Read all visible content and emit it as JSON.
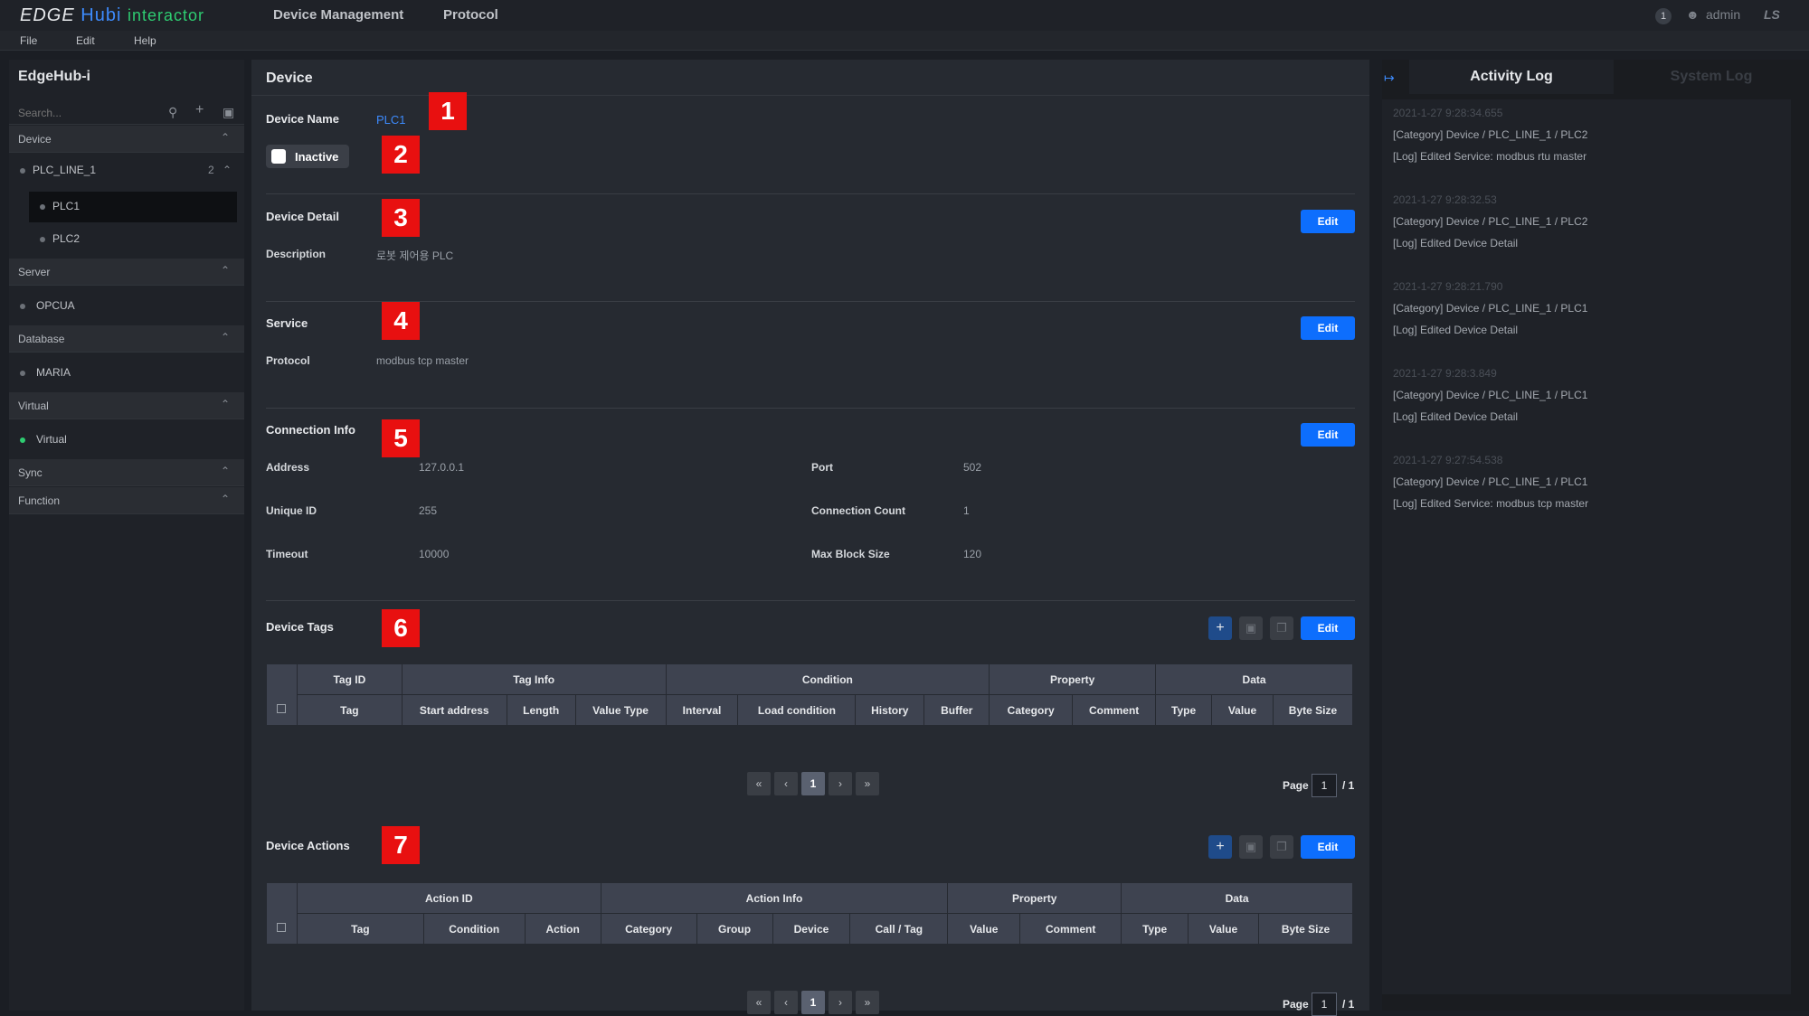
{
  "app": {
    "logo_main": "EDGE",
    "logo_hub": "Hub",
    "logo_sep": "i",
    "logo_sub": "interactor",
    "nav": [
      "Device Management",
      "Protocol"
    ],
    "menu": [
      "File",
      "Edit",
      "Help"
    ],
    "notification_count": "1",
    "user": "admin",
    "brand": "LS"
  },
  "sidebar": {
    "title": "EdgeHub-i",
    "search_placeholder": "Search...",
    "sections": {
      "device": "Device",
      "server": "Server",
      "database": "Database",
      "virtual": "Virtual",
      "sync": "Sync",
      "function": "Function"
    },
    "group": {
      "label": "PLC_LINE_1",
      "count": "2"
    },
    "devices": [
      "PLC1",
      "PLC2"
    ],
    "server_items": [
      "OPCUA"
    ],
    "database_items": [
      "MARIA"
    ],
    "virtual_items": [
      "Virtual"
    ]
  },
  "main": {
    "title": "Device",
    "device_name_label": "Device Name",
    "device_name": "PLC1",
    "status": "Inactive",
    "markers": [
      "1",
      "2",
      "3",
      "4",
      "5",
      "6",
      "7"
    ],
    "edit_label": "Edit",
    "detail": {
      "title": "Device Detail",
      "desc_label": "Description",
      "desc": "로봇 제어용 PLC"
    },
    "service": {
      "title": "Service",
      "protocol_label": "Protocol",
      "protocol": "modbus tcp master"
    },
    "connection": {
      "title": "Connection Info",
      "address_label": "Address",
      "address": "127.0.0.1",
      "port_label": "Port",
      "port": "502",
      "unique_id_label": "Unique ID",
      "unique_id": "255",
      "conn_count_label": "Connection Count",
      "conn_count": "1",
      "timeout_label": "Timeout",
      "timeout": "10000",
      "max_block_label": "Max Block Size",
      "max_block": "120"
    },
    "tags": {
      "title": "Device Tags",
      "groups": [
        "Tag ID",
        "Tag Info",
        "Condition",
        "Property",
        "Data"
      ],
      "columns": [
        "Tag",
        "Start address",
        "Length",
        "Value Type",
        "Interval",
        "Load condition",
        "History",
        "Buffer",
        "Category",
        "Comment",
        "Type",
        "Value",
        "Byte Size"
      ]
    },
    "actions": {
      "title": "Device Actions",
      "groups": [
        "Action ID",
        "Action Info",
        "Property",
        "Data"
      ],
      "columns": [
        "Tag",
        "Condition",
        "Action",
        "Category",
        "Group",
        "Device",
        "Call / Tag",
        "Value",
        "Comment",
        "Type",
        "Value",
        "Byte Size"
      ]
    },
    "pager": {
      "first": "«",
      "prev": "‹",
      "current": "1",
      "next": "›",
      "last": "»",
      "page_label": "Page",
      "page_value": "1",
      "total": "/ 1"
    }
  },
  "log": {
    "tabs": [
      "Activity Log",
      "System Log"
    ],
    "entries": [
      {
        "ts": "2021-1-27 9:28:34.655",
        "cat": "[Category] Device / PLC_LINE_1 / PLC2",
        "msg": "[Log] Edited Service: modbus rtu master"
      },
      {
        "ts": "2021-1-27 9:28:32.53",
        "cat": "[Category] Device / PLC_LINE_1 / PLC2",
        "msg": "[Log] Edited Device Detail"
      },
      {
        "ts": "2021-1-27 9:28:21.790",
        "cat": "[Category] Device / PLC_LINE_1 / PLC1",
        "msg": "[Log] Edited Device Detail"
      },
      {
        "ts": "2021-1-27 9:28:3.849",
        "cat": "[Category] Device / PLC_LINE_1 / PLC1",
        "msg": "[Log] Edited Device Detail"
      },
      {
        "ts": "2021-1-27 9:27:54.538",
        "cat": "[Category] Device / PLC_LINE_1 / PLC1",
        "msg": "[Log] Edited Service: modbus tcp master"
      }
    ]
  }
}
